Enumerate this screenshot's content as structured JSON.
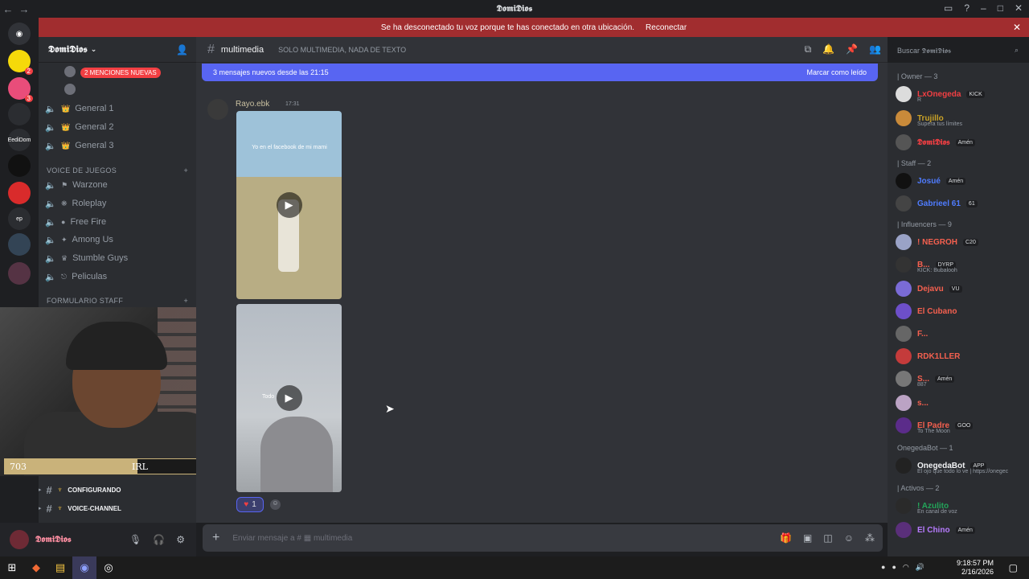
{
  "window": {
    "title": "𝕯𝖔𝖒𝖎𝕯𝖎𝖔𝖘"
  },
  "banner": {
    "message": "Se ha desconectado tu voz porque te has conectado en otra ubicación.",
    "action": "Reconectar"
  },
  "server": {
    "name": "𝕯𝖔𝖒𝖎𝕯𝖎𝖔𝖘"
  },
  "rail": {
    "servers": [
      {
        "label": "",
        "badge": "2",
        "color": "#f5d90a"
      },
      {
        "label": "",
        "badge": "3",
        "color": "#e94d7a"
      },
      {
        "label": "",
        "badge": "",
        "color": "#2b2d31"
      },
      {
        "label": "EediDom",
        "badge": "",
        "color": "#2b2d31"
      },
      {
        "label": "",
        "badge": "",
        "color": "#111111"
      },
      {
        "label": "",
        "badge": "",
        "color": "#d92b2b"
      },
      {
        "label": "ep",
        "badge": "",
        "color": "#2b2d31"
      },
      {
        "label": "",
        "badge": "",
        "color": "#334455"
      },
      {
        "label": "",
        "badge": "",
        "color": "#553344"
      }
    ]
  },
  "sidebar": {
    "mentions": "2 MENCIONES NUEVAS",
    "voice_top": [
      "General 1",
      "General 2",
      "General 3"
    ],
    "category_games": "VOICE DE JUEGOS",
    "games": [
      "Warzone",
      "Roleplay",
      "Free Fire",
      "Among Us",
      "Stumble Guys",
      "Peliculas"
    ],
    "category_staff": "FORMULARIO STAFF",
    "text_channels": [
      "CONFIGURANDO",
      "VOICE-CHANNEL"
    ]
  },
  "stream_overlay": {
    "current": "703",
    "label": "IRL",
    "goal": "1000",
    "progress": 0.703
  },
  "user_panel": {
    "name": "𝕯𝖔𝖒𝖎𝕯𝖎𝖔𝖘"
  },
  "chat": {
    "channel": "multimedia",
    "topic": "SOLO MULTIMEDIA, NADA DE TEXTO",
    "new_messages": "3 mensajes nuevos desde las 21:15",
    "mark_read": "Marcar como leído",
    "message": {
      "author": "Rayo.ebk",
      "time": "17:31",
      "video1_caption": "Yo en el facebook de mi mami",
      "video2_caption": "Todo",
      "reaction_count": "1"
    },
    "composer_placeholder": "Enviar mensaje a #",
    "composer_channel": "multimedia"
  },
  "members": {
    "search_placeholder": "Buscar 𝕯𝖔𝖒𝖎𝕯𝖎𝖔𝖘",
    "groups": [
      {
        "title": "| Owner — 3",
        "members": [
          {
            "name": "LxOnegeda",
            "tag": "KICK",
            "status": "R",
            "color": "#f23f43"
          },
          {
            "name": "Trujillo",
            "tag": "",
            "status": "Supera tus límites",
            "color": "#c9a227"
          },
          {
            "name": "𝕯𝖔𝖒𝖎𝕯𝖎𝖔𝖘",
            "tag": "Amén",
            "status": "",
            "color": "#f23f43"
          }
        ]
      },
      {
        "title": "| Staff — 2",
        "members": [
          {
            "name": "Josué",
            "tag": "Amén",
            "status": "",
            "color": "#4f7cff"
          },
          {
            "name": "Gabrieel 61",
            "tag": "61",
            "status": "",
            "color": "#4f7cff"
          }
        ]
      },
      {
        "title": "| Influencers — 9",
        "members": [
          {
            "name": "! NEGROH",
            "tag": "C20",
            "status": "",
            "color": "#f5604f"
          },
          {
            "name": "B...",
            "tag": "DYRP",
            "status": "KICK: Bubalooh",
            "color": "#f5604f"
          },
          {
            "name": "Dejavu",
            "tag": "VU",
            "status": "",
            "color": "#f5604f"
          },
          {
            "name": "El Cubano",
            "tag": "",
            "status": "",
            "color": "#f5604f"
          },
          {
            "name": "F...",
            "tag": "",
            "status": "",
            "color": "#f5604f"
          },
          {
            "name": "RDK1LLER",
            "tag": "",
            "status": "",
            "color": "#f5604f"
          },
          {
            "name": "S...",
            "tag": "Amén",
            "status": "887",
            "color": "#f5604f"
          },
          {
            "name": "s...",
            "tag": "",
            "status": "",
            "color": "#f5604f"
          },
          {
            "name": "El Padre",
            "tag": "GOO",
            "status": "To The Moon",
            "color": "#f5604f"
          }
        ]
      },
      {
        "title": "OnegedaBot — 1",
        "members": [
          {
            "name": "OnegedaBot",
            "tag": "APP",
            "status": "El ojo que todo lo ve | https://onegec",
            "color": "#f2f3f5"
          }
        ]
      },
      {
        "title": "| Activos — 2",
        "members": [
          {
            "name": "! Azulito",
            "tag": "",
            "status": "En canal de voz",
            "color": "#23a55a"
          },
          {
            "name": "El Chino",
            "tag": "Amén",
            "status": "",
            "color": "#b77bff"
          }
        ]
      }
    ]
  },
  "taskbar": {
    "time": "9:18:57 PM",
    "date": "2/16/2026"
  }
}
